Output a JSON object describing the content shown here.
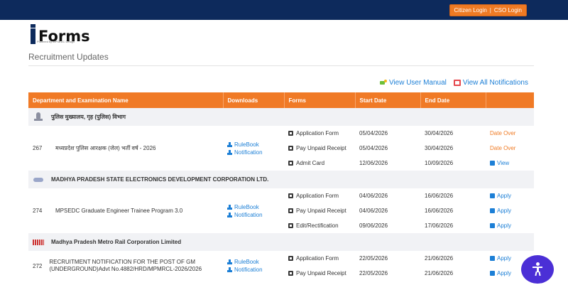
{
  "header": {
    "citizen_login": "Citizen Login",
    "separator": "|",
    "cso_login": "CSO Login"
  },
  "logo": {
    "brand": "Forms",
    "tagline": "Powered by MPSEDC Design"
  },
  "page": {
    "title": "Recruitment Updates"
  },
  "quick_links": {
    "manual": "View User Manual",
    "notifications": "View All Notifications"
  },
  "table": {
    "headers": [
      "Department and Examination Name",
      "Downloads",
      "Forms",
      "Start Date",
      "End Date",
      ""
    ],
    "groups": [
      {
        "org": "पुलिस मुख्यालय, गृह (पुलिस) विभाग",
        "icon": "police-emblem-icon",
        "exam": {
          "no": "267",
          "name": "मध्यप्रदेश पुलिस आरक्षक (जेल) भर्ती वर्ष - 2026",
          "downloads": [
            "RuleBook",
            "Notification"
          ],
          "rows": [
            {
              "form": "Application Form",
              "start": "05/04/2026",
              "end": "30/04/2026",
              "action": "Date Over",
              "type": "over"
            },
            {
              "form": "Pay Unpaid Receipt",
              "start": "05/04/2026",
              "end": "30/04/2026",
              "action": "Date Over",
              "type": "over"
            },
            {
              "form": "Admit Card",
              "start": "12/06/2026",
              "end": "10/09/2026",
              "action": "View",
              "type": "link"
            }
          ]
        }
      },
      {
        "org": "MADHYA PRADESH STATE ELECTRONICS DEVELOPMENT CORPORATION LTD.",
        "icon": "mpsedc-logo-icon",
        "exam": {
          "no": "274",
          "name": "MPSEDC Graduate Engineer Trainee Program 3.0",
          "downloads": [
            "RuleBook",
            "Notification"
          ],
          "rows": [
            {
              "form": "Application Form",
              "start": "04/06/2026",
              "end": "16/06/2026",
              "action": "Apply",
              "type": "link"
            },
            {
              "form": "Pay Unpaid Receipt",
              "start": "04/06/2026",
              "end": "16/06/2026",
              "action": "Apply",
              "type": "link"
            },
            {
              "form": "Edit/Rectification",
              "start": "09/06/2026",
              "end": "17/06/2026",
              "action": "Apply",
              "type": "link"
            }
          ]
        }
      },
      {
        "org": "Madhya Pradesh Metro Rail Corporation Limited",
        "icon": "metro-logo-icon",
        "exam": {
          "no": "272",
          "name": "RECRUITMENT NOTIFICATION FOR THE POST OF GM (UNDERGROUND)Advt No.4882/HRD/MPMRCL-2026/2026",
          "downloads": [
            "RuleBook",
            "Notification"
          ],
          "rows": [
            {
              "form": "Application Form",
              "start": "22/05/2026",
              "end": "21/06/2026",
              "action": "Apply",
              "type": "link"
            },
            {
              "form": "Pay Unpaid Receipt",
              "start": "22/05/2026",
              "end": "21/06/2026",
              "action": "Apply",
              "type": "link"
            }
          ]
        }
      }
    ]
  },
  "colors": {
    "topbar": "#0d2a5c",
    "accent_orange": "#f07a26",
    "link_blue": "#1c7fd6",
    "a11y_purple": "#4b2fd6"
  }
}
